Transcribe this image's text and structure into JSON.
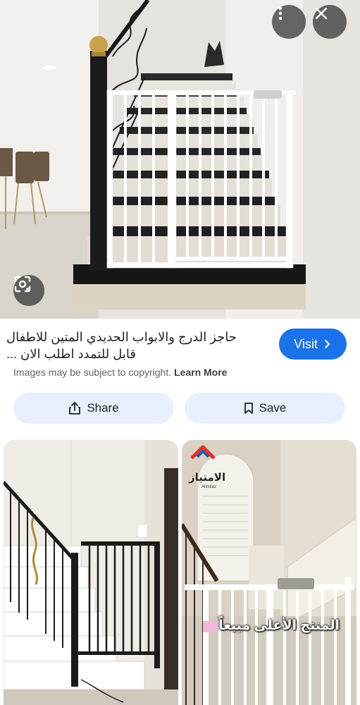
{
  "result": {
    "title": "حاجز الدرج والابواب الحديدي المتين للاطفال قابل للتمدد اطلب الان ...",
    "visit_label": "Visit",
    "copyright_text": "Images may be subject to copyright.",
    "learn_more": "Learn More"
  },
  "actions": {
    "share_label": "Share",
    "save_label": "Save"
  },
  "related": [
    {
      "caption": ""
    },
    {
      "caption": "المنتج الأعلى مبيعاً",
      "brand": "الامتياز",
      "brand_sub": "Alimtiaz"
    }
  ],
  "colors": {
    "accent": "#1a73e8",
    "pill_bg": "#e8f0fe"
  },
  "icons": [
    "more-vert-icon",
    "close-icon",
    "lens-icon",
    "chevron-right-icon",
    "share-icon",
    "bookmark-icon"
  ]
}
